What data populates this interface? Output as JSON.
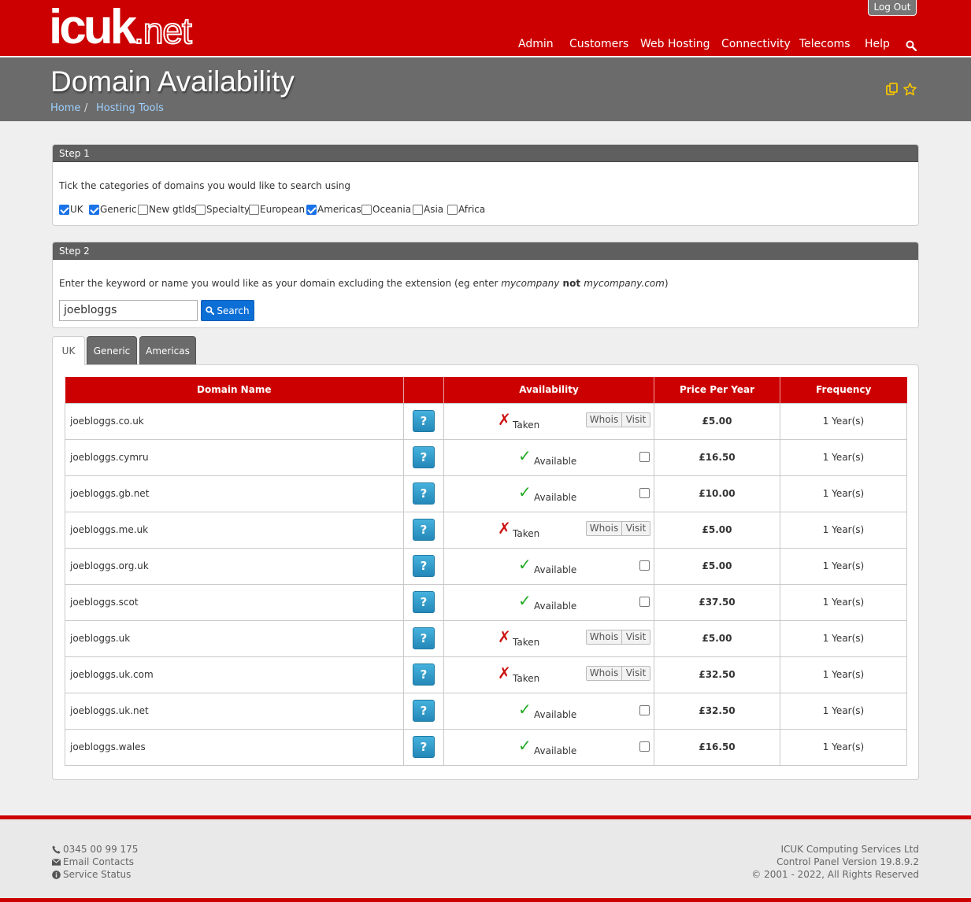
{
  "header": {
    "logo": {
      "main": "icuk",
      "suffix": ".net"
    },
    "logout_label": "Log Out",
    "nav": [
      "Admin",
      "Customers",
      "Web Hosting",
      "Connectivity",
      "Telecoms",
      "Help"
    ]
  },
  "title": {
    "text": "Domain Availability",
    "breadcrumbs": [
      "Home",
      "Hosting Tools"
    ],
    "separator": "/"
  },
  "step1": {
    "heading": "Step 1",
    "instruction": "Tick the categories of domains you would like to search using",
    "categories": [
      {
        "label": "UK",
        "checked": true
      },
      {
        "label": "Generic",
        "checked": true
      },
      {
        "label": "New gtlds",
        "checked": false
      },
      {
        "label": "Specialty",
        "checked": false
      },
      {
        "label": "European",
        "checked": false
      },
      {
        "label": "Americas",
        "checked": true
      },
      {
        "label": "Oceania",
        "checked": false
      },
      {
        "label": "Asia",
        "checked": false
      },
      {
        "label": "Africa",
        "checked": false
      }
    ]
  },
  "step2": {
    "heading": "Step 2",
    "instruction_a": "Enter the keyword or name you would like as your domain excluding the extension (eg enter ",
    "example_a": "mycompany",
    "instruction_b": " not ",
    "example_b": "mycompany.com",
    "instruction_c": ")",
    "keyword_value": "joebloggs",
    "search_label": "Search"
  },
  "tabs": [
    "UK",
    "Generic",
    "Americas"
  ],
  "table": {
    "headers": [
      "Domain Name",
      "",
      "Availability",
      "Price Per Year",
      "Frequency"
    ],
    "help_label": "?",
    "whois_label": "Whois",
    "visit_label": "Visit",
    "rows": [
      {
        "domain": "joebloggs.co.uk",
        "status": "Taken",
        "price": "£5.00",
        "freq": "1 Year(s)"
      },
      {
        "domain": "joebloggs.cymru",
        "status": "Available",
        "price": "£16.50",
        "freq": "1 Year(s)"
      },
      {
        "domain": "joebloggs.gb.net",
        "status": "Available",
        "price": "£10.00",
        "freq": "1 Year(s)"
      },
      {
        "domain": "joebloggs.me.uk",
        "status": "Taken",
        "price": "£5.00",
        "freq": "1 Year(s)"
      },
      {
        "domain": "joebloggs.org.uk",
        "status": "Available",
        "price": "£5.00",
        "freq": "1 Year(s)"
      },
      {
        "domain": "joebloggs.scot",
        "status": "Available",
        "price": "£37.50",
        "freq": "1 Year(s)"
      },
      {
        "domain": "joebloggs.uk",
        "status": "Taken",
        "price": "£5.00",
        "freq": "1 Year(s)"
      },
      {
        "domain": "joebloggs.uk.com",
        "status": "Taken",
        "price": "£32.50",
        "freq": "1 Year(s)"
      },
      {
        "domain": "joebloggs.uk.net",
        "status": "Available",
        "price": "£32.50",
        "freq": "1 Year(s)"
      },
      {
        "domain": "joebloggs.wales",
        "status": "Available",
        "price": "£16.50",
        "freq": "1 Year(s)"
      }
    ]
  },
  "footer": {
    "phone": "0345 00 99 175",
    "email": "Email Contacts",
    "status": "Service Status",
    "company": "ICUK Computing Services Ltd",
    "version": "Control Panel Version 19.8.9.2",
    "copyright": "© 2001 - 2022, All Rights Reserved"
  },
  "colors": {
    "brand_red": "#cc0000",
    "title_band": "#6b6b6b",
    "link_blue": "#9ed0ff",
    "button_blue": "#0b6fd6",
    "help_blue": "#2488b8",
    "taken_red": "#cc1111",
    "available_green": "#22aa22",
    "star_yellow": "#f5c400"
  },
  "icons": {
    "search": "search-icon",
    "copy": "copy-icon",
    "star": "star-icon",
    "phone": "phone-icon",
    "email": "envelope-icon",
    "info": "info-icon",
    "taken": "cross-icon",
    "available": "check-icon"
  }
}
